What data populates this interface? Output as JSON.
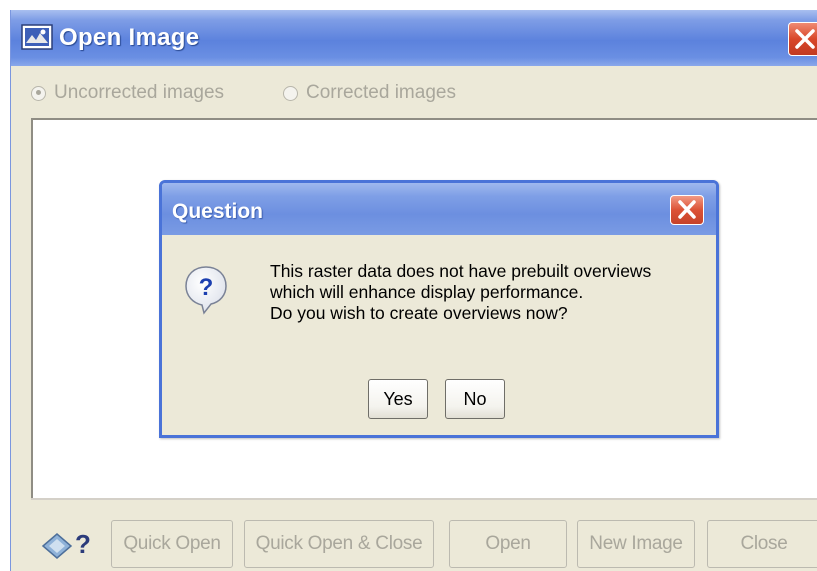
{
  "window": {
    "title": "Open Image",
    "icon": "image-window-icon",
    "close_icon": "close-icon"
  },
  "radio_options": [
    {
      "label": "Uncorrected images",
      "checked": true,
      "enabled": false
    },
    {
      "label": "Corrected images",
      "checked": false,
      "enabled": false
    }
  ],
  "dialog": {
    "title": "Question",
    "icon": "question-icon",
    "close_icon": "close-icon",
    "message_lines": [
      "This raster data does not have prebuilt overviews",
      "which will enhance display performance.",
      "Do you wish to create overviews now?"
    ],
    "yes_label": "Yes",
    "no_label": "No"
  },
  "toolbar": {
    "help_icon": "help-icon",
    "quick_open_label": "Quick Open",
    "quick_open_close_label": "Quick Open & Close",
    "open_label": "Open",
    "new_image_label": "New Image",
    "close_label": "Close"
  },
  "colors": {
    "titlebar_blue": "#5c82dd",
    "dialog_border": "#4a73d8",
    "close_red": "#d9472a",
    "window_face": "#ece9d8",
    "disabled_text": "#a9a79c"
  }
}
